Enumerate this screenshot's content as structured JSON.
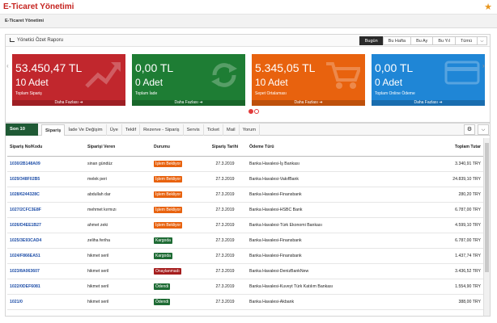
{
  "app": {
    "title": "E-Ticaret Yönetimi",
    "subtitle": "E-Ticaret Yönetimi"
  },
  "report": {
    "title": "Yönetici Özet Raporu",
    "periods": [
      "Bugün",
      "Bu Hafta",
      "Bu Ay",
      "Bu Yıl",
      "Tümü"
    ],
    "active_period": "Bugün",
    "cards": [
      {
        "amount": "53.450,47 TL",
        "count": "10 Adet",
        "label": "Toplam Sipariş",
        "more": "Daha Fazlası ➔",
        "color": "#c1272d",
        "icon": "trend-up-icon"
      },
      {
        "amount": "0,00 TL",
        "count": "0 Adet",
        "label": "Toplam İade",
        "more": "Daha Fazlası ➔",
        "color": "#1e7d34",
        "icon": "refresh-icon"
      },
      {
        "amount": "5.345,05 TL",
        "count": "10 Adet",
        "label": "Sepet Ortalaması",
        "more": "Daha Fazlası ➔",
        "color": "#e8620e",
        "icon": "cart-icon"
      },
      {
        "amount": "0,00 TL",
        "count": "0 Adet",
        "label": "Toplam Online Ödeme",
        "more": "Daha Fazlası ➔",
        "color": "#1f86d6",
        "icon": "credit-card-icon"
      }
    ]
  },
  "orders": {
    "son_label": "Son 10",
    "tabs": [
      "Sipariş",
      "İade Ve Değişim",
      "Üye",
      "Teklif",
      "Rezerve - Sipariş",
      "Servis",
      "Ticket",
      "Mail",
      "Yorum"
    ],
    "active_tab": "Sipariş",
    "columns": [
      "Sipariş No/Kodu",
      "Siparişi Veren",
      "Durumu",
      "Sipariş Tarihi",
      "Ödeme Türü",
      "Toplam Tutar"
    ],
    "rows": [
      {
        "code": "1030/2B148A09",
        "customer": "sinan gündüz",
        "status": "İşlem Bekliyor",
        "status_color": "#e8620e",
        "date": "27.3.2019",
        "payment": "Banka Havalesi-İş Bankası",
        "total": "3.340,91 TRY"
      },
      {
        "code": "1029/348F02B5",
        "customer": "melek peri",
        "status": "İşlem Bekliyor",
        "status_color": "#e8620e",
        "date": "27.3.2019",
        "payment": "Banka Havalesi-VakıfBank",
        "total": "24.839,10 TRY"
      },
      {
        "code": "1028/6244328C",
        "customer": "abdullah dar",
        "status": "İşlem Bekliyor",
        "status_color": "#e8620e",
        "date": "27.3.2019",
        "payment": "Banka Havalesi-Finansbank",
        "total": "280,20 TRY"
      },
      {
        "code": "1027/2CFC3E8F",
        "customer": "mehmet kırmızı",
        "status": "İşlem Bekliyor",
        "status_color": "#e8620e",
        "date": "27.3.2019",
        "payment": "Banka Havalesi-HSBC Bank",
        "total": "6.787,00 TRY"
      },
      {
        "code": "1026/D4EE1B27",
        "customer": "ahmet zeki",
        "status": "İşlem Bekliyor",
        "status_color": "#e8620e",
        "date": "27.3.2019",
        "payment": "Banka Havalesi-Türk Ekonomi Bankası",
        "total": "4.599,10 TRY"
      },
      {
        "code": "1025/3E93CAD4",
        "customer": "zeliha feriha",
        "status": "Kargoda",
        "status_color": "#1e6b34",
        "date": "27.3.2019",
        "payment": "Banka Havalesi-Finansbank",
        "total": "6.787,00 TRY"
      },
      {
        "code": "1024/F866EA51",
        "customer": "hikmet seril",
        "status": "Kargoda",
        "status_color": "#1e6b34",
        "date": "27.3.2019",
        "payment": "Banka Havalesi-Finansbank",
        "total": "1.437,74 TRY"
      },
      {
        "code": "1023/8A063607",
        "customer": "hikmet seril",
        "status": "Onaylanmadı",
        "status_color": "#a51d1d",
        "date": "27.3.2019",
        "payment": "Banka Havalesi-DenizBankNew",
        "total": "3.436,52 TRY"
      },
      {
        "code": "1022/0DEF6081",
        "customer": "hikmet seril",
        "status": "Ödendi",
        "status_color": "#1e6b34",
        "date": "27.3.2019",
        "payment": "Banka Havalesi-Kuveyt Türk Katılım Bankası",
        "total": "1.554,90 TRY"
      },
      {
        "code": "1021/0",
        "customer": "hikmet seril",
        "status": "Ödendi",
        "status_color": "#1e6b34",
        "date": "27.3.2019",
        "payment": "Banka Havalesi-Akbank",
        "total": "388,00 TRY"
      }
    ]
  }
}
